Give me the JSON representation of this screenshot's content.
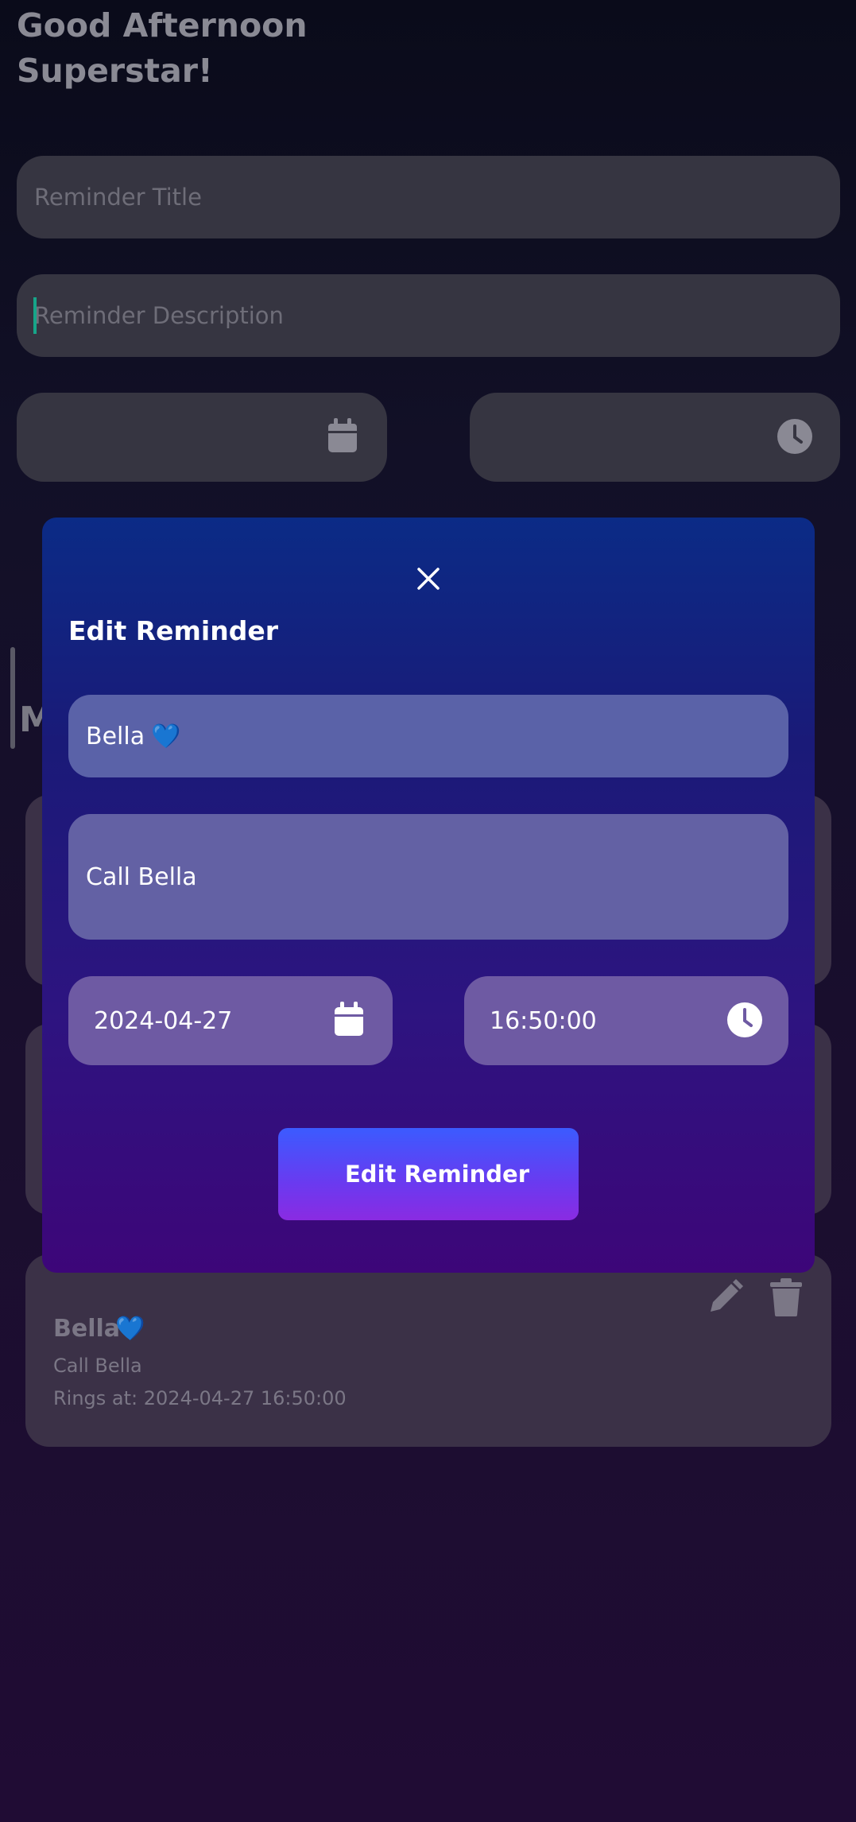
{
  "greeting": {
    "line1": "Good Afternoon",
    "line2": "Superstar!"
  },
  "form": {
    "title_placeholder": "Reminder Title",
    "description_placeholder": "Reminder Description",
    "date_icon": "calendar-icon",
    "time_icon": "clock-icon"
  },
  "list": {
    "heading_initial": "M",
    "card": {
      "title": "Bella",
      "title_emoji": "💙",
      "description": "Call Bella",
      "rings_at": "Rings at: 2024-04-27 16:50:00",
      "edit_icon": "pencil-icon",
      "delete_icon": "trash-icon"
    }
  },
  "modal": {
    "close_icon": "close-icon",
    "title": "Edit Reminder",
    "title_field": "Bella",
    "title_emoji": "💙",
    "description_field": "Call Bella",
    "date_value": "2024-04-27",
    "time_value": "16:50:00",
    "submit_label": "Edit Reminder"
  },
  "colors": {
    "accent_gradient_top": "#3b5bff",
    "accent_gradient_bottom": "#8a2be2",
    "modal_top": "#0b2b86",
    "modal_bottom": "#3d0679"
  }
}
